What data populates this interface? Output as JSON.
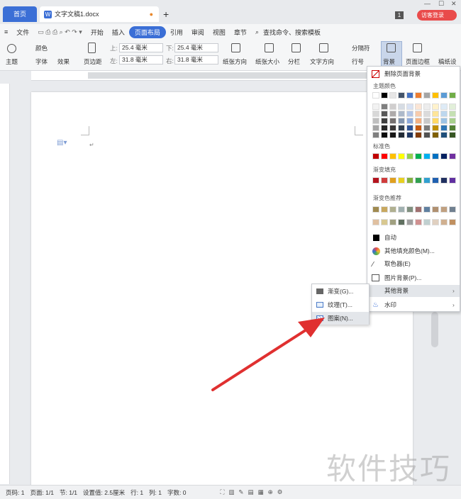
{
  "titlebar": {
    "home_tab": "首页",
    "doc_tab": "文字文稿1.docx",
    "badge": "1",
    "login": "访客登录"
  },
  "menu": {
    "file": "文件",
    "items": [
      "开始",
      "插入",
      "页面布局",
      "引用",
      "审阅",
      "视图",
      "章节"
    ],
    "active": "页面布局",
    "search": "查找命令、搜索模板"
  },
  "ribbon": {
    "theme": "主题",
    "color": "颜色",
    "font": "字体",
    "effect": "效果",
    "margin": "页边距",
    "top_label": "上:",
    "top": "25.4 毫米",
    "bottom_label": "下:",
    "bottom": "25.4 毫米",
    "left_label": "左:",
    "left": "31.8 毫米",
    "right_label": "右:",
    "right": "31.8 毫米",
    "orientation": "纸张方向",
    "size": "纸张大小",
    "columns": "分栏",
    "text_dir": "文字方向",
    "separator": "分隔符",
    "line_no": "行号",
    "background": "背景",
    "border": "页面边框",
    "manuscript": "稿纸设"
  },
  "dropdown": {
    "remove_bg": "删除页面背景",
    "theme_colors": "主题颜色",
    "standard_colors": "标准色",
    "gradient_fill": "渐变填充",
    "gradient_recommend": "渐变色推荐",
    "auto": "自动",
    "more_fill": "其他填充颜色(M)...",
    "picker": "取色器(E)",
    "picture_bg": "图片背景(P)...",
    "other_bg": "其他背景",
    "watermark": "水印"
  },
  "submenu": {
    "gradient": "渐变(G)...",
    "texture": "纹理(T)...",
    "pattern": "图案(N)..."
  },
  "colors": {
    "theme_row1": [
      "#ffffff",
      "#000000",
      "#e7e6e6",
      "#44546a",
      "#4472c4",
      "#ed7d31",
      "#a5a5a5",
      "#ffc000",
      "#5b9bd5",
      "#70ad47"
    ],
    "theme_rows": [
      [
        "#f2f2f2",
        "#7f7f7f",
        "#d0cece",
        "#d6dce4",
        "#d9e2f3",
        "#fbe5d5",
        "#ededed",
        "#fff2cc",
        "#deebf6",
        "#e2efd9"
      ],
      [
        "#d8d8d8",
        "#595959",
        "#aeaaaa",
        "#adb9ca",
        "#b4c6e7",
        "#f7cbac",
        "#dbdbdb",
        "#fee599",
        "#bdd7ee",
        "#c5e0b3"
      ],
      [
        "#bfbfbf",
        "#3f3f3f",
        "#757070",
        "#8496b0",
        "#8eaadb",
        "#f4b183",
        "#c9c9c9",
        "#ffd965",
        "#9cc3e5",
        "#a8d08d"
      ],
      [
        "#a5a5a5",
        "#262626",
        "#3a3838",
        "#323f4f",
        "#2f5496",
        "#c55a11",
        "#7b7b7b",
        "#bf9000",
        "#2e75b5",
        "#538135"
      ],
      [
        "#7f7f7f",
        "#0c0c0c",
        "#171616",
        "#222a35",
        "#1f3864",
        "#833c0b",
        "#525252",
        "#7f6000",
        "#1f4e79",
        "#375623"
      ]
    ],
    "standard": [
      "#c00000",
      "#ff0000",
      "#ffc000",
      "#ffff00",
      "#92d050",
      "#00b050",
      "#00b0f0",
      "#0070c0",
      "#002060",
      "#7030a0"
    ],
    "gradient": [
      "#b4141e",
      "#d03c3c",
      "#e0a020",
      "#e8d020",
      "#80b040",
      "#30a050",
      "#30a0d0",
      "#2060b0",
      "#203060",
      "#6030a0"
    ],
    "recommend1": [
      "#a08a50",
      "#c8a860",
      "#b0b090",
      "#a0b0b0",
      "#809080",
      "#a07070",
      "#6080a0",
      "#b09070",
      "#c0a080",
      "#708090"
    ],
    "recommend2": [
      "#e0c0a0",
      "#d8c890",
      "#a0a080",
      "#607060",
      "#a0a0a0",
      "#d09090",
      "#c0d0d0",
      "#e0d0c0",
      "#d0b090",
      "#c09060"
    ],
    "accent": "#3b6fd6",
    "red": "#e94b4b"
  },
  "status": {
    "page_no": "页码: 1",
    "pages": "页面: 1/1",
    "section": "节: 1/1",
    "setting": "设置值: 2.5厘米",
    "row": "行: 1",
    "col": "列: 1",
    "words": "字数: 0"
  },
  "watermark": "软件技巧"
}
